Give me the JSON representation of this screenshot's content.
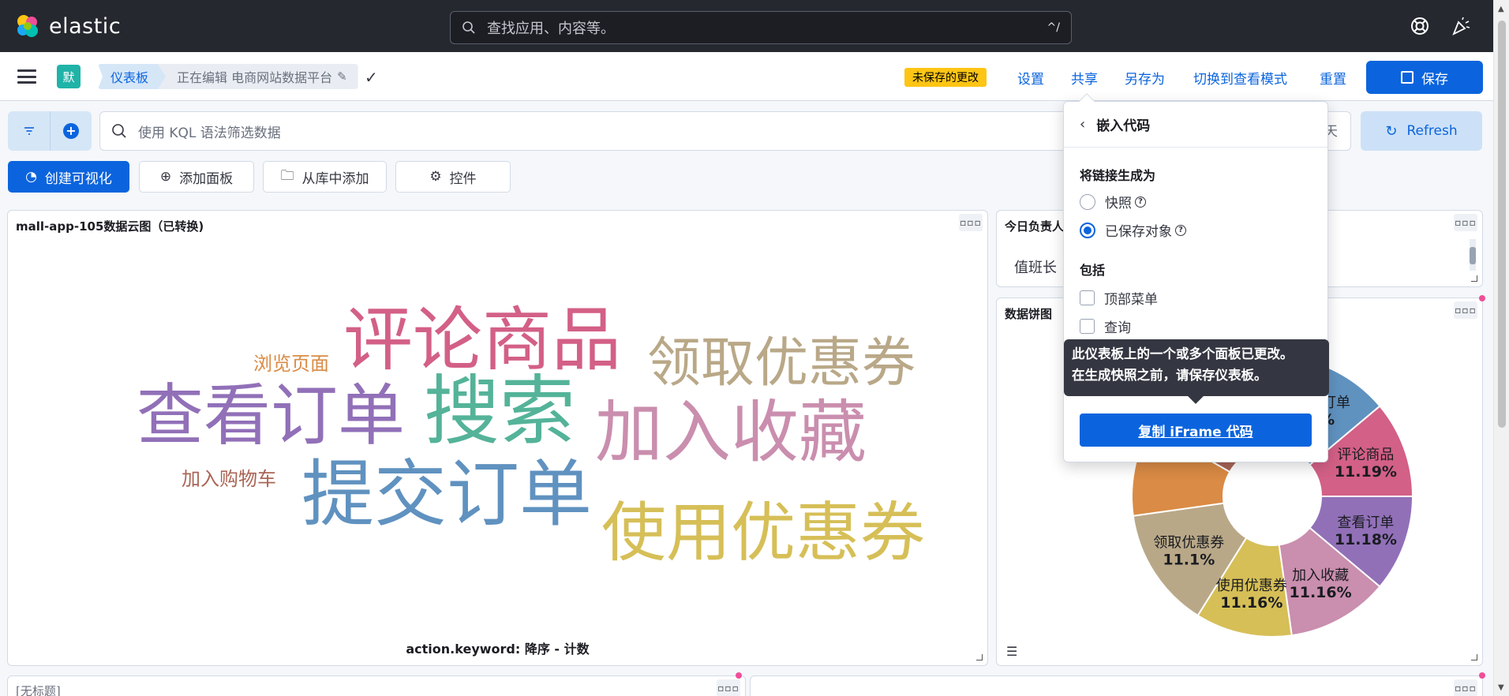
{
  "app": {
    "logo_text": "elastic"
  },
  "search": {
    "placeholder": "查找应用、内容等。",
    "shortcut": "^/"
  },
  "header": {
    "space_initial": "默",
    "breadcrumb_root": "仪表板",
    "breadcrumb_current": "正在编辑 电商网站数据平台",
    "unsaved_badge": "未保存的更改",
    "links": {
      "settings": "设置",
      "share": "共享",
      "save_as": "另存为",
      "view_mode": "切换到查看模式",
      "reset": "重置"
    },
    "save_label": "保存"
  },
  "query": {
    "placeholder": "使用 KQL 语法筛选数据",
    "date_tail": "天",
    "refresh_label": "Refresh"
  },
  "toolbar": {
    "create_viz": "创建可视化",
    "add_panel": "添加面板",
    "add_from_library": "从库中添加",
    "controls": "控件"
  },
  "panels": {
    "wordcloud": {
      "title": "mall-app-105数据云图（已转换)",
      "caption": "action.keyword: 降序 - 计数",
      "words": [
        {
          "text": "评论商品",
          "color": "#d36086"
        },
        {
          "text": "浏览页面",
          "color": "#da8b45"
        },
        {
          "text": "领取优惠券",
          "color": "#b9a888"
        },
        {
          "text": "查看订单",
          "color": "#9170b8"
        },
        {
          "text": "搜索",
          "color": "#54b399"
        },
        {
          "text": "加入收藏",
          "color": "#ca8eae"
        },
        {
          "text": "加入购物车",
          "color": "#aa6556"
        },
        {
          "text": "提交订单",
          "color": "#6092c0"
        },
        {
          "text": "使用优惠券",
          "color": "#d6bf57"
        }
      ]
    },
    "duty": {
      "title": "今日负责人",
      "body": "值班长"
    },
    "pie": {
      "title": "数据饼图"
    },
    "untitled": {
      "title": "[无标题]"
    }
  },
  "chart_data": {
    "type": "pie",
    "donut": true,
    "slices": [
      {
        "label": "提交订单",
        "value_text": "2%",
        "color": "#6092c0"
      },
      {
        "label": "评论商品",
        "value": 11.19,
        "value_text": "11.19%",
        "color": "#d36086"
      },
      {
        "label": "查看订单",
        "value": 11.18,
        "value_text": "11.18%",
        "color": "#9170b8"
      },
      {
        "label": "加入收藏",
        "value": 11.16,
        "value_text": "11.16%",
        "color": "#ca8eae"
      },
      {
        "label": "使用优惠券",
        "value": 11.16,
        "value_text": "11.16%",
        "color": "#d6bf57"
      },
      {
        "label": "领取优惠券",
        "value": 11.1,
        "value_text": "11.1%",
        "color": "#b9a888"
      }
    ]
  },
  "share_popover": {
    "title": "嵌入代码",
    "generate_as_label": "将链接生成为",
    "options": {
      "snapshot": "快照",
      "saved_object": "已保存对象"
    },
    "include_label": "包括",
    "includes": {
      "top_menu": "顶部菜单",
      "query": "查询"
    },
    "tooltip_line1": "此仪表板上的一个或多个面板已更改。",
    "tooltip_line2": "在生成快照之前，请保存仪表板。",
    "copy_button": "复制 iFrame 代码"
  }
}
